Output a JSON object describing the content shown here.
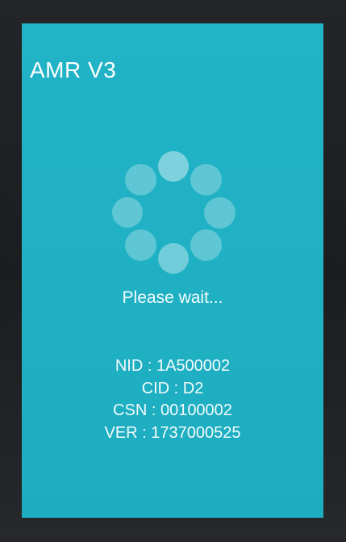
{
  "app": {
    "title": "AMR V3"
  },
  "status": {
    "message": "Please wait..."
  },
  "device_info": {
    "nid": "NID : 1A500002",
    "cid": "CID : D2",
    "csn": "CSN : 00100002",
    "ver": "VER : 1737000525"
  },
  "colors": {
    "screen_background": "#1fb0c3",
    "text": "#ffffff",
    "spinner_dot": "rgba(255,255,255,0.28)",
    "device_bezel": "#1b1d20"
  },
  "icons": {
    "loading": "loading-spinner-icon"
  }
}
